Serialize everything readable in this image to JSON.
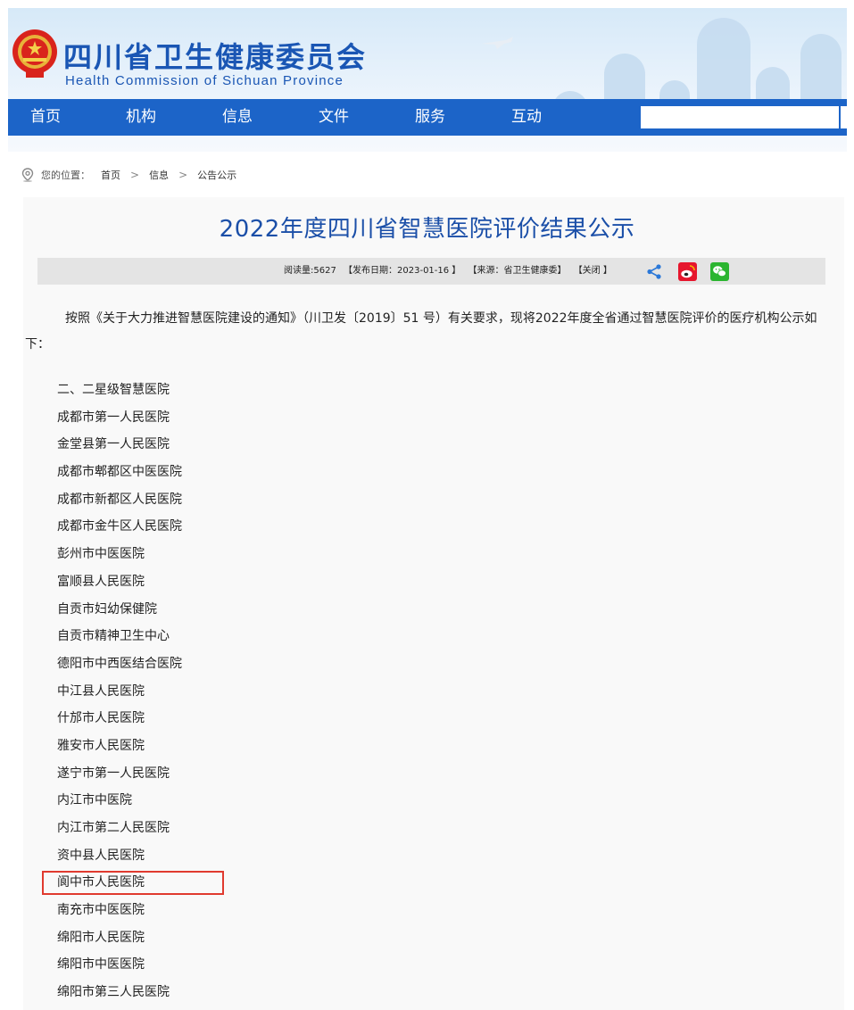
{
  "header": {
    "title_cn": "四川省卫生健康委员会",
    "title_en": "Health Commission of Sichuan Province"
  },
  "nav": {
    "items": [
      "首页",
      "机构",
      "信息",
      "文件",
      "服务",
      "互动"
    ],
    "search_value": ""
  },
  "breadcrumb": {
    "label": "您的位置：",
    "items": [
      "首页",
      "信息",
      "公告公示"
    ],
    "separator": ">"
  },
  "article": {
    "title": "2022年度四川省智慧医院评价结果公示",
    "meta": {
      "views": "阅读量:5627",
      "date": "【发布日期：2023-01-16 】",
      "source": "【来源：省卫生健康委】",
      "close": "【关闭 】"
    },
    "intro": "按照《关于大力推进智慧医院建设的通知》（川卫发〔2019〕51 号）有关要求，现将2022年度全省通过智慧医院评价的医疗机构公示如下：",
    "section": "二、二星级智慧医院",
    "hospitals": [
      "成都市第一人民医院",
      "金堂县第一人民医院",
      "成都市郫都区中医医院",
      "成都市新都区人民医院",
      "成都市金牛区人民医院",
      "彭州市中医医院",
      "富顺县人民医院",
      "自贡市妇幼保健院",
      "自贡市精神卫生中心",
      "德阳市中西医结合医院",
      "中江县人民医院",
      "什邡市人民医院",
      "雅安市人民医院",
      "遂宁市第一人民医院",
      "内江市中医院",
      "内江市第二人民医院",
      "资中县人民医院",
      "阆中市人民医院",
      "南充市中医医院",
      "绵阳市人民医院",
      "绵阳市中医医院",
      "绵阳市第三人民医院"
    ]
  },
  "colors": {
    "brand": "#1a56b4",
    "nav_bg": "#1c64c8",
    "highlight": "#e03a2f",
    "weibo": "#e6162d",
    "wechat": "#2bb530",
    "share": "#2b78d8"
  },
  "icons": [
    "national-emblem-icon",
    "location-pin-icon",
    "share-icon",
    "weibo-icon",
    "wechat-icon"
  ]
}
